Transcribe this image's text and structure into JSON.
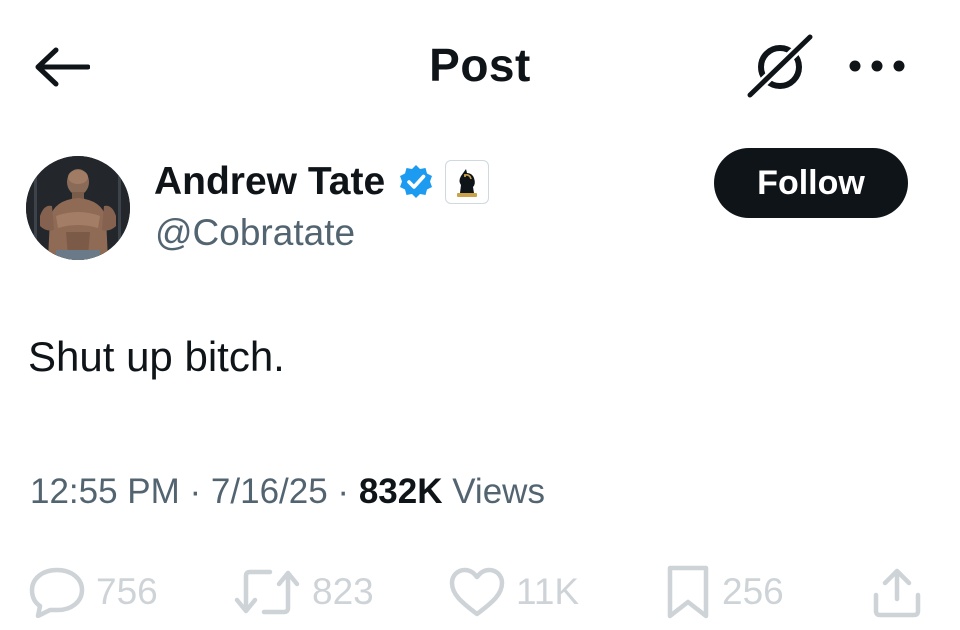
{
  "header": {
    "title": "Post",
    "back_icon": "arrow-left-icon",
    "grok_icon": "grok-icon",
    "more_icon": "more-horizontal-icon"
  },
  "author": {
    "display_name": "Andrew Tate",
    "handle": "@Cobratate",
    "verified_color": "#1d9bf0",
    "affiliation_icon": "chess-knight-icon",
    "follow_label": "Follow"
  },
  "post": {
    "text": "Shut up bitch.",
    "time": "12:55 PM",
    "separator1": " · ",
    "date": "7/16/25",
    "separator2": " · ",
    "views_count": "832K",
    "views_label": " Views"
  },
  "actions": {
    "replies": "756",
    "reposts": "823",
    "likes": "11K",
    "bookmarks": "256"
  },
  "colors": {
    "text_primary": "#0f1419",
    "text_secondary": "#536471",
    "button_bg": "#0f1419",
    "verified": "#1d9bf0"
  }
}
